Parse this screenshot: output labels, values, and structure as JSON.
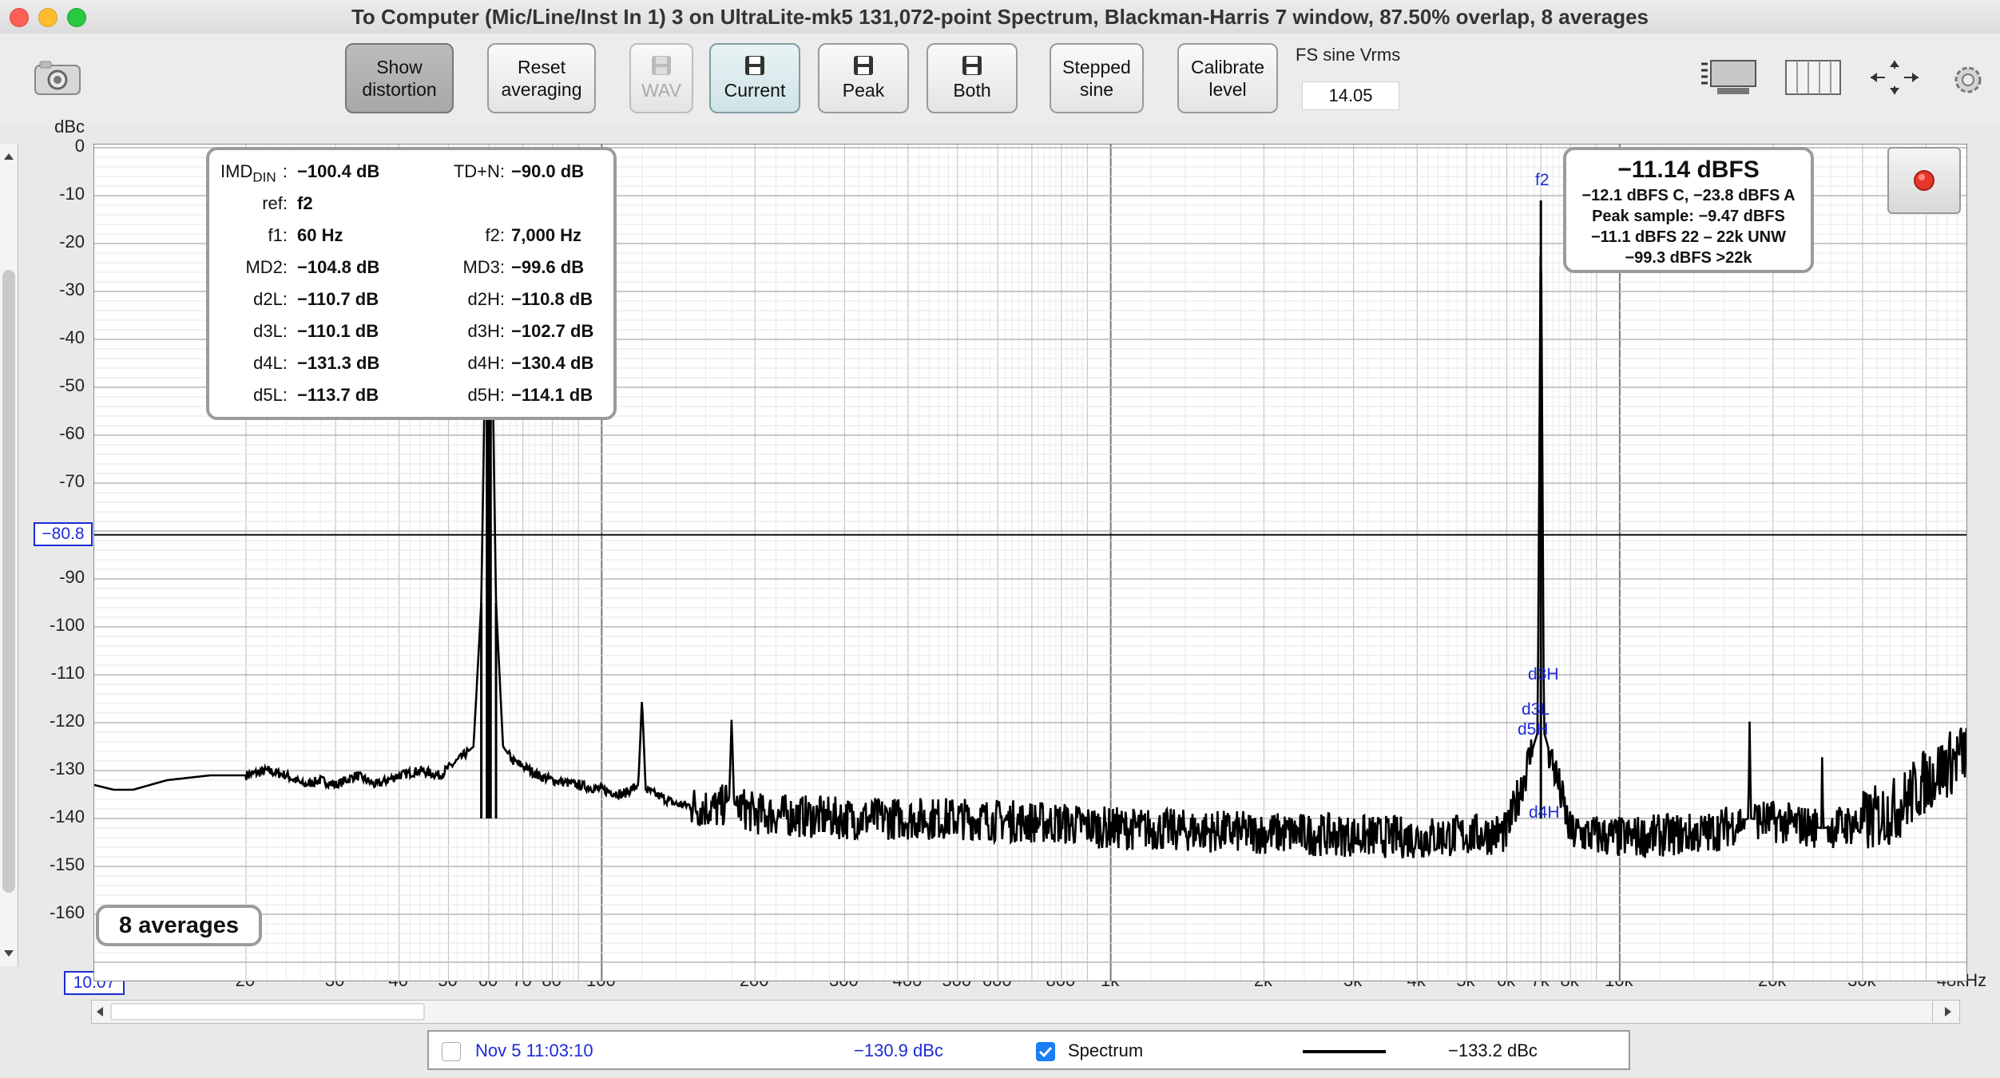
{
  "window": {
    "title": "To Computer (Mic/Line/Inst In 1) 3 on UltraLite-mk5 131,072-point Spectrum, Blackman-Harris 7 window, 87.50% overlap, 8 averages"
  },
  "toolbar": {
    "show_distortion": [
      "Show",
      "distortion"
    ],
    "reset_averaging": [
      "Reset",
      "averaging"
    ],
    "wav": "WAV",
    "current": "Current",
    "peak": "Peak",
    "both": "Both",
    "stepped_sine": [
      "Stepped",
      "sine"
    ],
    "calibrate_level": [
      "Calibrate",
      "level"
    ],
    "fs_sine_label": "FS sine Vrms",
    "fs_sine_value": "14.05"
  },
  "plot": {
    "y_unit": "dBc",
    "y_ticks": [
      "0",
      "-10",
      "-20",
      "-30",
      "-40",
      "-50",
      "-60",
      "-70",
      "-90",
      "-100",
      "-110",
      "-120",
      "-130",
      "-140",
      "-150",
      "-160"
    ],
    "cursor_value": "−80.8",
    "x_start": "10.07",
    "x_ticks": [
      "20",
      "30",
      "40",
      "50",
      "60",
      "70",
      "80",
      "100",
      "200",
      "300",
      "400",
      "500",
      "600",
      "800",
      "1k",
      "2k",
      "3k",
      "4k",
      "5k",
      "6k",
      "7k",
      "8k",
      "10k",
      "20k",
      "30k",
      "48kHz"
    ],
    "averages_badge": "8 averages",
    "peak_labels": {
      "f2": "f2",
      "d3H": "d3H",
      "d3L": "d3L",
      "d5H": "d5H",
      "d4H": "d4H"
    }
  },
  "distortion_panel": {
    "imd_label": "IMD",
    "imd_sub": "DIN",
    "rows": [
      {
        "l_label": ":",
        "l_value": "−100.4 dB",
        "r_label": "TD+N:",
        "r_value": "−90.0 dB"
      },
      {
        "l_label": "ref:",
        "l_value": "f2",
        "r_label": "",
        "r_value": ""
      },
      {
        "l_label": "f1:",
        "l_value": "60 Hz",
        "r_label": "f2:",
        "r_value": "7,000 Hz"
      },
      {
        "l_label": "MD2:",
        "l_value": "−104.8 dB",
        "r_label": "MD3:",
        "r_value": "−99.6 dB"
      },
      {
        "l_label": "d2L:",
        "l_value": "−110.7 dB",
        "r_label": "d2H:",
        "r_value": "−110.8 dB"
      },
      {
        "l_label": "d3L:",
        "l_value": "−110.1 dB",
        "r_label": "d3H:",
        "r_value": "−102.7 dB"
      },
      {
        "l_label": "d4L:",
        "l_value": "−131.3 dB",
        "r_label": "d4H:",
        "r_value": "−130.4 dB"
      },
      {
        "l_label": "d5L:",
        "l_value": "−113.7 dB",
        "r_label": "d5H:",
        "r_value": "−114.1 dB"
      }
    ]
  },
  "level_panel": {
    "main": "−11.14 dBFS",
    "lines": [
      "−12.1 dBFS C, −23.8 dBFS A",
      "Peak sample: −9.47 dBFS",
      "−11.1 dBFS 22 – 22k UNW",
      "−99.3 dBFS >22k"
    ]
  },
  "legend": {
    "timestamp": "Nov 5 11:03:10",
    "timestamp_value": "−130.9 dBc",
    "spectrum_label": "Spectrum",
    "spectrum_value": "−133.2 dBc"
  },
  "chart_data": {
    "type": "line",
    "x_scale": "log",
    "x_range_hz": [
      10.07,
      48000
    ],
    "y_range_dbc": [
      -170,
      0
    ],
    "cursor_dbc": -80.8,
    "grid": true,
    "series": [
      {
        "name": "Spectrum",
        "points_hz_dbc": [
          [
            10.07,
            -133
          ],
          [
            11,
            -134
          ],
          [
            12,
            -134
          ],
          [
            14,
            -132
          ],
          [
            17,
            -131
          ],
          [
            20,
            -131
          ],
          [
            22,
            -130
          ],
          [
            24,
            -131
          ],
          [
            26,
            -133
          ],
          [
            28,
            -132
          ],
          [
            30,
            -133
          ],
          [
            33,
            -131
          ],
          [
            36,
            -133
          ],
          [
            40,
            -131
          ],
          [
            44,
            -130
          ],
          [
            48,
            -131
          ],
          [
            52,
            -128
          ],
          [
            56,
            -125
          ],
          [
            58,
            -95
          ],
          [
            59.5,
            -20
          ],
          [
            60,
            0
          ],
          [
            60.5,
            -20
          ],
          [
            62,
            -95
          ],
          [
            64,
            -125
          ],
          [
            67,
            -128
          ],
          [
            70,
            -129
          ],
          [
            75,
            -131
          ],
          [
            80,
            -132
          ],
          [
            90,
            -133
          ],
          [
            100,
            -134
          ],
          [
            110,
            -135
          ],
          [
            118,
            -133
          ],
          [
            120,
            -115
          ],
          [
            122,
            -134
          ],
          [
            140,
            -137
          ],
          [
            170,
            -138
          ],
          [
            178,
            -136
          ],
          [
            180,
            -119
          ],
          [
            182,
            -137
          ],
          [
            200,
            -139
          ],
          [
            300,
            -140
          ],
          [
            500,
            -140
          ],
          [
            800,
            -141
          ],
          [
            1000,
            -142
          ],
          [
            2000,
            -143
          ],
          [
            4000,
            -144
          ],
          [
            6000,
            -143
          ],
          [
            6500,
            -131
          ],
          [
            6900,
            -122
          ],
          [
            7000,
            -11
          ],
          [
            7100,
            -122
          ],
          [
            7500,
            -131
          ],
          [
            8000,
            -143
          ],
          [
            10000,
            -144
          ],
          [
            15000,
            -143
          ],
          [
            17900,
            -140
          ],
          [
            18000,
            -119
          ],
          [
            18100,
            -140
          ],
          [
            24900,
            -142
          ],
          [
            25000,
            -125
          ],
          [
            25100,
            -142
          ],
          [
            30000,
            -141
          ],
          [
            35000,
            -138
          ],
          [
            40000,
            -132
          ],
          [
            48000,
            -126
          ]
        ]
      }
    ]
  }
}
